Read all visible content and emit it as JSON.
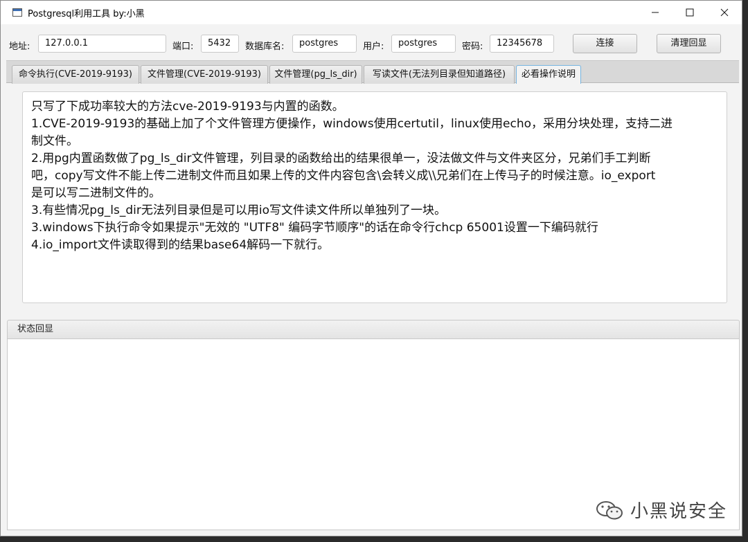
{
  "window": {
    "title": "Postgresql利用工具  by:小黑",
    "controls": {
      "minimize": "—",
      "maximize": "☐",
      "close": "✕"
    }
  },
  "connection": {
    "address_label": "地址:",
    "address_value": "127.0.0.1",
    "port_label": "端口:",
    "port_value": "5432",
    "dbname_label": "数据库名:",
    "dbname_value": "postgres",
    "user_label": "用户:",
    "user_value": "postgres",
    "password_label": "密码:",
    "password_value": "12345678",
    "connect_button": "连接",
    "clear_button": "清理回显"
  },
  "tabs": [
    {
      "label": "命令执行(CVE-2019-9193)",
      "active": false
    },
    {
      "label": "文件管理(CVE-2019-9193)",
      "active": false
    },
    {
      "label": "文件管理(pg_ls_dir)",
      "active": false
    },
    {
      "label": "写读文件(无法列目录但知道路径)",
      "active": false
    },
    {
      "label": "必看操作说明",
      "active": true
    }
  ],
  "content": {
    "lines": [
      "只写了下成功率较大的方法cve-2019-9193与内置的函数。",
      "1.CVE-2019-9193的基础上加了个文件管理方便操作，windows使用certutil，linux使用echo，采用分块处理，支持二进",
      "制文件。",
      "2.用pg内置函数做了pg_ls_dir文件管理，列目录的函数给出的结果很单一，没法做文件与文件夹区分，兄弟们手工判断",
      "吧，copy写文件不能上传二进制文件而且如果上传的文件内容包含\\会转义成\\\\兄弟们在上传马子的时候注意。io_export",
      "是可以写二进制文件的。",
      "3.有些情况pg_ls_dir无法列目录但是可以用io写文件读文件所以单独列了一块。",
      "3.windows下执行命令如果提示\"无效的 \"UTF8\" 编码字节顺序\"的话在命令行chcp 65001设置一下编码就行",
      "4.io_import文件读取得到的结果base64解码一下就行。"
    ]
  },
  "status": {
    "title": "状态回显",
    "text": ""
  },
  "watermark": {
    "text": "小黑说安全",
    "icon": "wechat-icon"
  },
  "colors": {
    "active_tab_border": "#76b4e0",
    "titlebar_bg": "#ffffff",
    "window_bg": "#f3f3f3"
  }
}
